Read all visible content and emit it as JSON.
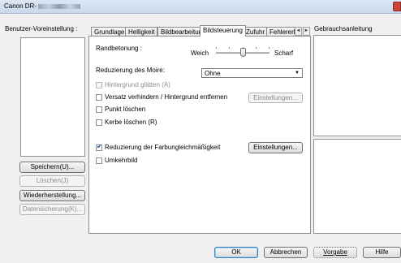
{
  "window": {
    "title": "Canon DR-"
  },
  "profiles": {
    "label": "Benutzer-Voreinstellung :",
    "save_button": "Speichern(U)...",
    "delete_button": "Löschen(J)",
    "restore_button": "Wiederherstellung...",
    "backup_button": "Datensicherung(K)..."
  },
  "tabs": [
    {
      "label": "Grundlage"
    },
    {
      "label": "Helligkeit"
    },
    {
      "label": "Bildbearbeitung"
    },
    {
      "label": "Bildsteuerung"
    },
    {
      "label": "Zufuhr"
    },
    {
      "label": "Fehlererk"
    }
  ],
  "tab_scroll": {
    "left": "◄",
    "right": "►"
  },
  "bildsteuerung": {
    "edge_label": "Randbetonung :",
    "edge_min": "Weich",
    "edge_max": "Scharf",
    "edge_level": 0.5,
    "moire_label": "Reduzierung des Moire:",
    "moire_value": "Ohne",
    "bg_smooth": "Hintergrund glätten (A)",
    "offset_label": "Versatz verhindern / Hintergrund entfernen",
    "offset_settings": "Einstellungen...",
    "dot_remove": "Punkt löschen",
    "notch_remove": "Kerbe löschen (R)",
    "color_uniformity": "Reduzierung der Farbungleichmäßigkeit",
    "color_settings": "Einstellungen...",
    "invert": "Umkehrbild"
  },
  "help_panel": {
    "label": "Gebrauchsanleitung"
  },
  "footer": {
    "ok": "OK",
    "cancel": "Abbrechen",
    "defaults": "Vorgabe",
    "help": "Hilfe"
  },
  "colors": {
    "accent": "#3c7fb1",
    "window_bg": "#f0f0f0",
    "close": "#c9463d"
  }
}
